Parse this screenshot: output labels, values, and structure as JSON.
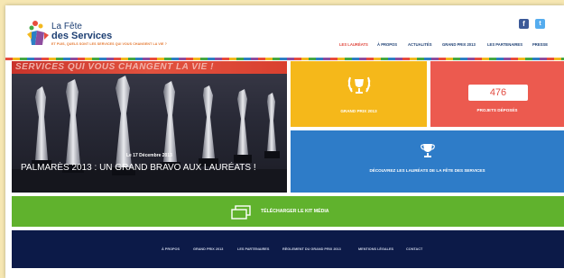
{
  "header": {
    "logo_line1": "La Fête",
    "logo_line2": "des Services",
    "tagline": "ET PUIS, QUELS SONT LES SERVICES QUI VOUS CHANGENT LA VIE ?",
    "social": [
      {
        "label": "f",
        "icon": "facebook-icon"
      },
      {
        "label": "t",
        "icon": "twitter-icon"
      }
    ],
    "nav": [
      {
        "label": "LES LAURÉATS",
        "active": true
      },
      {
        "label": "À PROPOS"
      },
      {
        "label": "ACTUALITÉS"
      },
      {
        "label": "GRAND PRIX 2013"
      },
      {
        "label": "LES PARTENAIRES"
      },
      {
        "label": "PRESSE"
      }
    ]
  },
  "hero": {
    "banner_text": "SERVICES QUI VOUS CHANGENT LA VIE !",
    "date": "Le 17 Décembre 2013",
    "title": "PALMARÈS 2013 : UN GRAND BRAVO AUX LAURÉATS !"
  },
  "tiles": {
    "grand_prix": {
      "label": "GRAND PRIX 2013",
      "icon": "laurel-trophy-icon"
    },
    "projects": {
      "count": "476",
      "label": "PROJETS DÉPOSÉS"
    },
    "laureats": {
      "label": "DÉCOUVREZ LES LAURÉATS DE LA FÊTE DES SERVICES",
      "icon": "trophy-icon"
    }
  },
  "kit": {
    "label": "TÉLÉCHARGER LE KIT MÉDIA",
    "icon": "windows-icon"
  },
  "footer": {
    "links": [
      "À PROPOS",
      "GRAND PRIX 2013",
      "LES PARTENAIRES",
      "RÈGLEMENT DU GRAND PRIX 2013",
      "MENTIONS LÉGALES",
      "CONTACT"
    ]
  },
  "colors": {
    "accent_yellow": "#f5b81a",
    "accent_red": "#ec5a4f",
    "accent_blue": "#2e7cc8",
    "accent_green": "#60b22d",
    "footer_navy": "#0c1a48",
    "nav_active": "#e0473d"
  }
}
